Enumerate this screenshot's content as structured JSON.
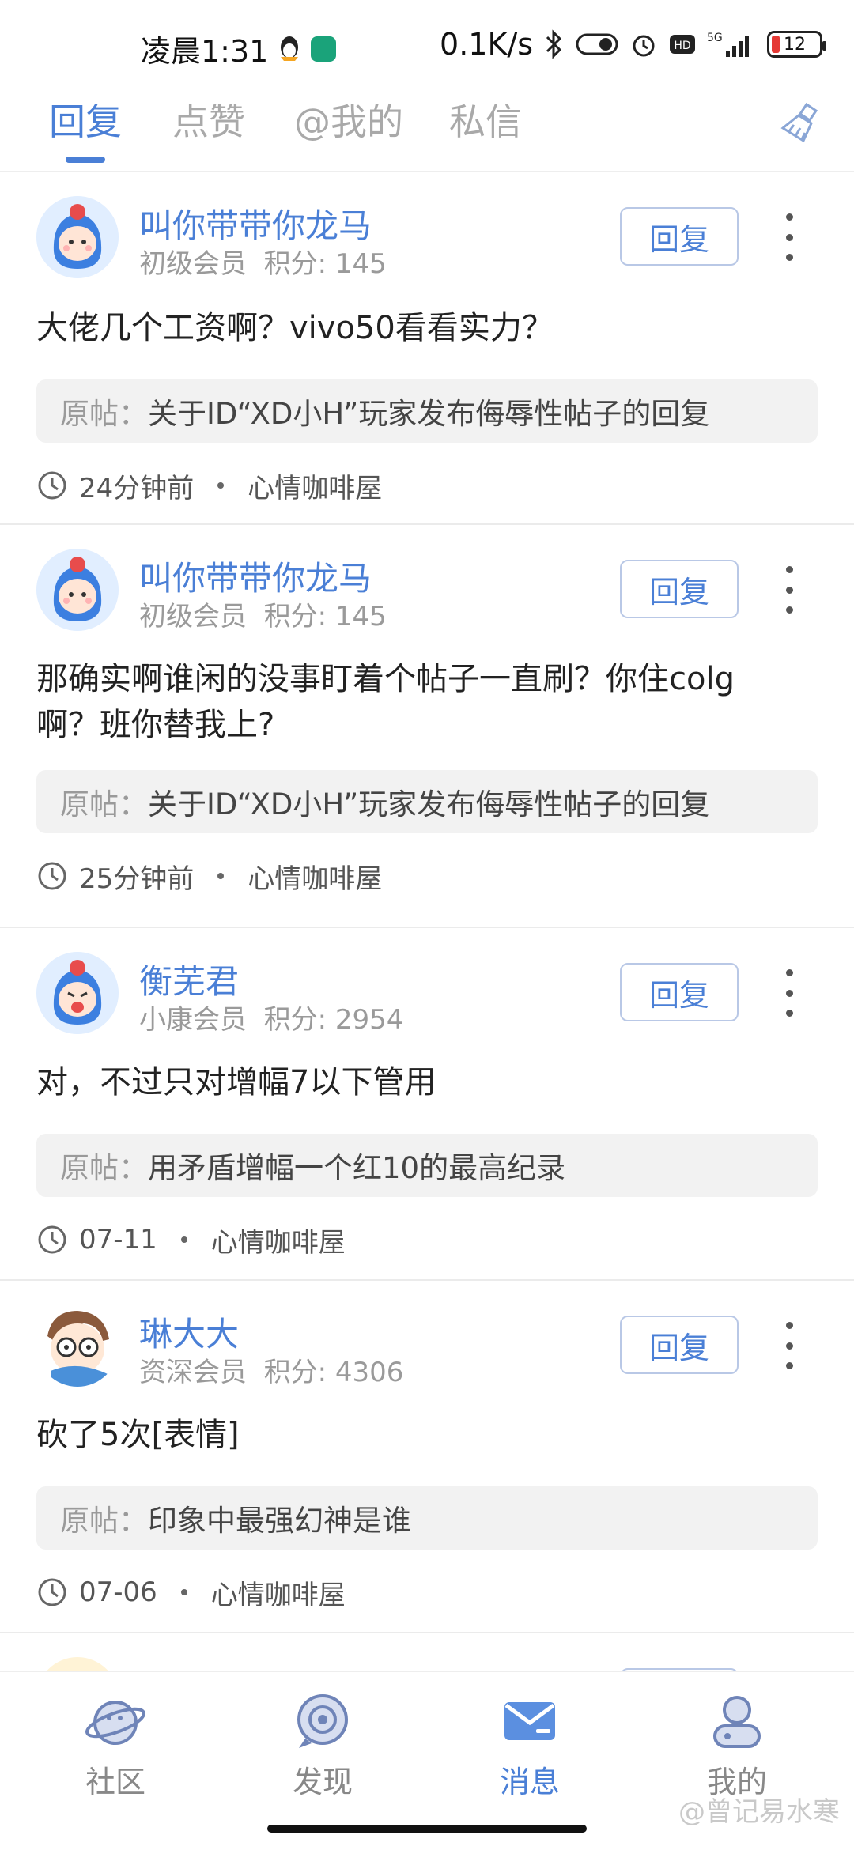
{
  "status_bar": {
    "time": "凌晨1:31",
    "net_speed": "0.1K/s",
    "network": "5G",
    "battery": "12"
  },
  "tabs": [
    {
      "label": "回复",
      "active": true
    },
    {
      "label": "点赞",
      "active": false
    },
    {
      "label": "@我的",
      "active": false
    },
    {
      "label": "私信",
      "active": false
    }
  ],
  "items": [
    {
      "username": "叫你带带你龙马",
      "level": "初级会员",
      "points": "积分: 145",
      "reply_label": "回复",
      "content": "大佬几个工资啊？vivo50看看实力？",
      "orig_prefix": "原帖：",
      "orig_title": "关于ID“XD小H”玩家发布侮辱性帖子的回复",
      "time": "24分钟前",
      "forum": "心情咖啡屋"
    },
    {
      "username": "叫你带带你龙马",
      "level": "初级会员",
      "points": "积分: 145",
      "reply_label": "回复",
      "content": "那确实啊谁闲的没事盯着个帖子一直刷？你住colg啊？班你替我上?",
      "orig_prefix": "原帖：",
      "orig_title": "关于ID“XD小H”玩家发布侮辱性帖子的回复",
      "time": "25分钟前",
      "forum": "心情咖啡屋"
    },
    {
      "username": "衡芜君",
      "level": "小康会员",
      "points": "积分: 2954",
      "reply_label": "回复",
      "content": "对，不过只对增幅7以下管用",
      "orig_prefix": "原帖：",
      "orig_title": "用矛盾增幅一个红10的最高纪录",
      "time": "07-11",
      "forum": "心情咖啡屋"
    },
    {
      "username": "琳大大",
      "level": "资深会员",
      "points": "积分: 4306",
      "reply_label": "回复",
      "content": "砍了5次[表情]",
      "orig_prefix": "原帖：",
      "orig_title": "印象中最强幻神是谁",
      "time": "07-06",
      "forum": "心情咖啡屋"
    }
  ],
  "bottom_nav": [
    {
      "label": "社区",
      "icon": "planet-icon",
      "active": false
    },
    {
      "label": "发现",
      "icon": "discover-icon",
      "active": false
    },
    {
      "label": "消息",
      "icon": "mail-icon",
      "active": true
    },
    {
      "label": "我的",
      "icon": "profile-icon",
      "active": false
    }
  ],
  "watermark": "@曾记易水寒",
  "colors": {
    "accent": "#4a7fd6",
    "muted": "#9a9a9a"
  }
}
